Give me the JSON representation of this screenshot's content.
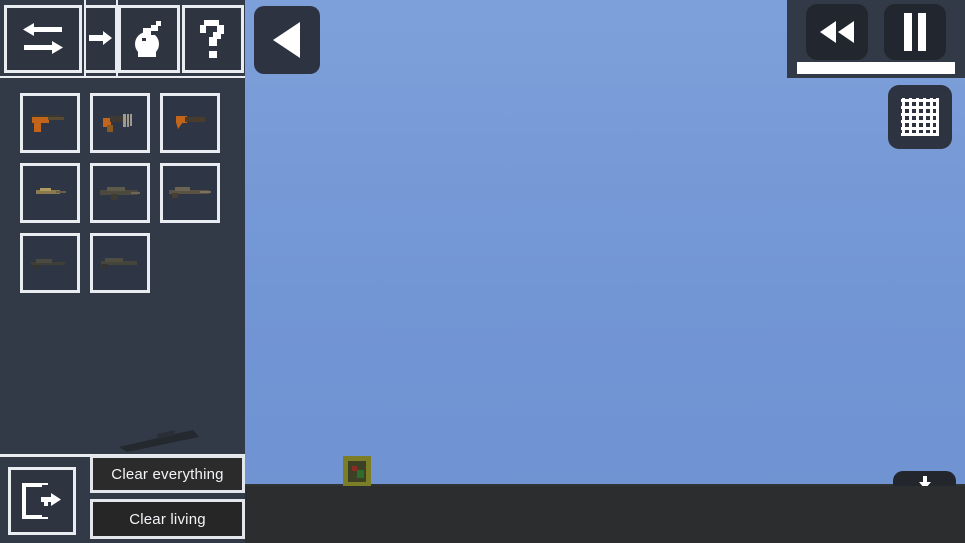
{
  "app": {
    "title": "Sandbox Weapon Spawner",
    "colors": {
      "sky": "#7295d4",
      "ground": "#2b2d2e",
      "panel": "#333a47",
      "slot_bg": "#2e3646",
      "outline": "#e9ecf1",
      "button_dark": "#2b2b2b",
      "accent_orange": "#c2651a"
    }
  },
  "toolbar": {
    "buttons": [
      {
        "name": "swap-direction-button",
        "icon": "swap-arrows-icon",
        "label": "Swap"
      },
      {
        "name": "advance-button",
        "icon": "arrow-right-icon",
        "label": "Advance"
      },
      {
        "name": "explosives-button",
        "icon": "grenade-icon",
        "label": "Explosives"
      },
      {
        "name": "help-button",
        "icon": "question-mark-icon",
        "label": "Help"
      }
    ]
  },
  "inventory": {
    "title": "Weapons",
    "slots": [
      {
        "index": 1,
        "name": "pistol",
        "label": "Pistol",
        "tint": "#c2651a",
        "style": "pistol"
      },
      {
        "index": 2,
        "name": "smg",
        "label": "SMG",
        "tint": "#c2651a",
        "style": "smg"
      },
      {
        "index": 3,
        "name": "sawed-off",
        "label": "Sawed-off",
        "tint": "#c2651a",
        "style": "sawed"
      },
      {
        "index": 4,
        "name": "carbine",
        "label": "Carbine",
        "tint": "#8a7a4e",
        "style": "carbine"
      },
      {
        "index": 5,
        "name": "assault-rifle",
        "label": "Assault Rifle",
        "tint": "#5d5a4a",
        "style": "rifle"
      },
      {
        "index": 6,
        "name": "battle-rifle",
        "label": "Battle Rifle",
        "tint": "#6b6454",
        "style": "rifle2"
      },
      {
        "index": 7,
        "name": "sniper-rifle",
        "label": "Sniper Rifle",
        "tint": "#4a4a42",
        "style": "sniper"
      },
      {
        "index": 8,
        "name": "marksman-rifle",
        "label": "Marksman Rifle",
        "tint": "#4f4d42",
        "style": "sniper2"
      }
    ]
  },
  "bottom_panel": {
    "exit_button": {
      "name": "exit-button",
      "icon": "exit-door-icon",
      "label": "Exit"
    },
    "clear_everything_label": "Clear everything",
    "clear_living_label": "Clear living"
  },
  "game_overlay": {
    "back_button": {
      "name": "back-button",
      "icon": "triangle-left-icon",
      "label": "Back"
    },
    "rewind_button": {
      "name": "rewind-button",
      "icon": "rewind-icon",
      "label": "Rewind"
    },
    "pause_button": {
      "name": "pause-button",
      "icon": "pause-icon",
      "label": "Pause"
    },
    "progress": {
      "name": "time-progress-bar",
      "value": 100,
      "max": 100,
      "fill_color": "#ffffff"
    },
    "grid_button": {
      "name": "grid-toggle-button",
      "icon": "grid-icon",
      "label": "Grid"
    },
    "download_button": {
      "name": "download-button",
      "icon": "download-icon",
      "label": "Save"
    }
  },
  "world": {
    "entity": {
      "name": "crate-entity",
      "label": "Crate"
    }
  }
}
